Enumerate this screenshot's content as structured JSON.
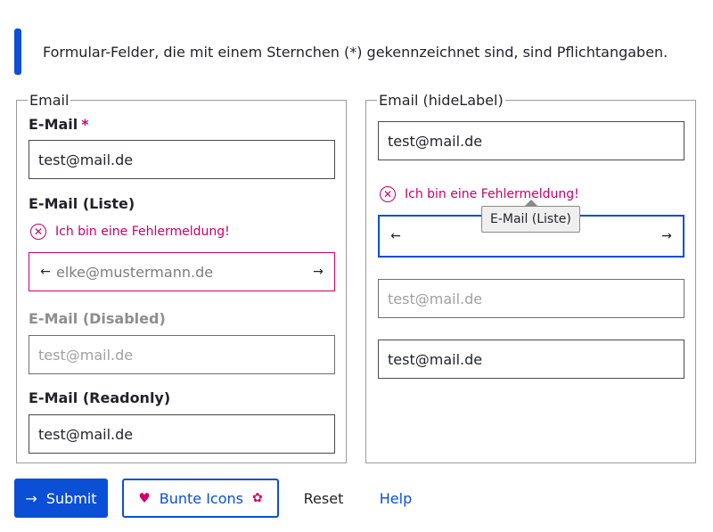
{
  "notice": {
    "text": "Formular-Felder, die mit einem Sternchen (*) gekennzeichnet sind, sind Pflichtangaben."
  },
  "left_fieldset": {
    "legend": "Email",
    "email": {
      "label": "E-Mail",
      "required_mark": "*",
      "value": "test@mail.de"
    },
    "email_list": {
      "label": "E-Mail (Liste)",
      "error": "Ich bin eine Fehlermeldung!",
      "placeholder": "elke@mustermann.de"
    },
    "email_disabled": {
      "label": "E-Mail (Disabled)",
      "value": "test@mail.de"
    },
    "email_readonly": {
      "label": "E-Mail (Readonly)",
      "value": "test@mail.de"
    }
  },
  "right_fieldset": {
    "legend": "Email (hideLabel)",
    "email": {
      "value": "test@mail.de"
    },
    "email_list": {
      "error": "Ich bin eine Fehlermeldung!",
      "tooltip": "E-Mail (Liste)"
    },
    "email_disabled": {
      "value": "test@mail.de"
    },
    "email_readonly": {
      "value": "test@mail.de"
    }
  },
  "buttons": {
    "submit": "Submit",
    "bunte_icons": "Bunte Icons",
    "reset": "Reset",
    "help": "Help"
  },
  "icons": {
    "arrow_left": "arrow-left-icon",
    "arrow_right": "arrow-right-icon",
    "error": "error-circle-icon",
    "heart": "heart-icon",
    "squirrel": "squirrel-icon"
  },
  "colors": {
    "primary": "#0b4fd6",
    "error": "#c8006a",
    "required": "#d4006a"
  }
}
